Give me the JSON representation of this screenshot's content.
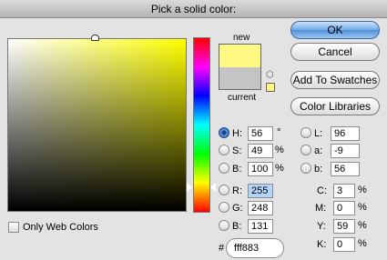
{
  "window": {
    "title": "Pick a solid color:"
  },
  "swatches": {
    "new_label": "new",
    "current_label": "current",
    "new_color": "#fff883",
    "current_color": "#c4c4c4"
  },
  "buttons": {
    "ok": "OK",
    "cancel": "Cancel",
    "add_to_swatches": "Add To Swatches",
    "color_libraries": "Color Libraries"
  },
  "hsb": {
    "h_label": "H:",
    "h_value": "56",
    "h_unit": "°",
    "s_label": "S:",
    "s_value": "49",
    "s_unit": "%",
    "b_label": "B:",
    "b_value": "100",
    "b_unit": "%"
  },
  "rgb": {
    "r_label": "R:",
    "r_value": "255",
    "g_label": "G:",
    "g_value": "248",
    "b_label": "B:",
    "b_value": "131"
  },
  "lab": {
    "l_label": "L:",
    "l_value": "96",
    "a_label": "a:",
    "a_value": "-9",
    "b_label": "b:",
    "b_value": "56"
  },
  "cmyk": {
    "c_label": "C:",
    "c_value": "3",
    "m_label": "M:",
    "m_value": "0",
    "y_label": "Y:",
    "y_value": "59",
    "k_label": "K:",
    "k_value": "0",
    "unit": "%"
  },
  "hex": {
    "label": "#",
    "value": "fff883"
  },
  "options": {
    "only_web_colors": "Only Web Colors"
  },
  "icons": {
    "gamut_warning": "cube-icon"
  },
  "accent_color": "#4f8fd8"
}
